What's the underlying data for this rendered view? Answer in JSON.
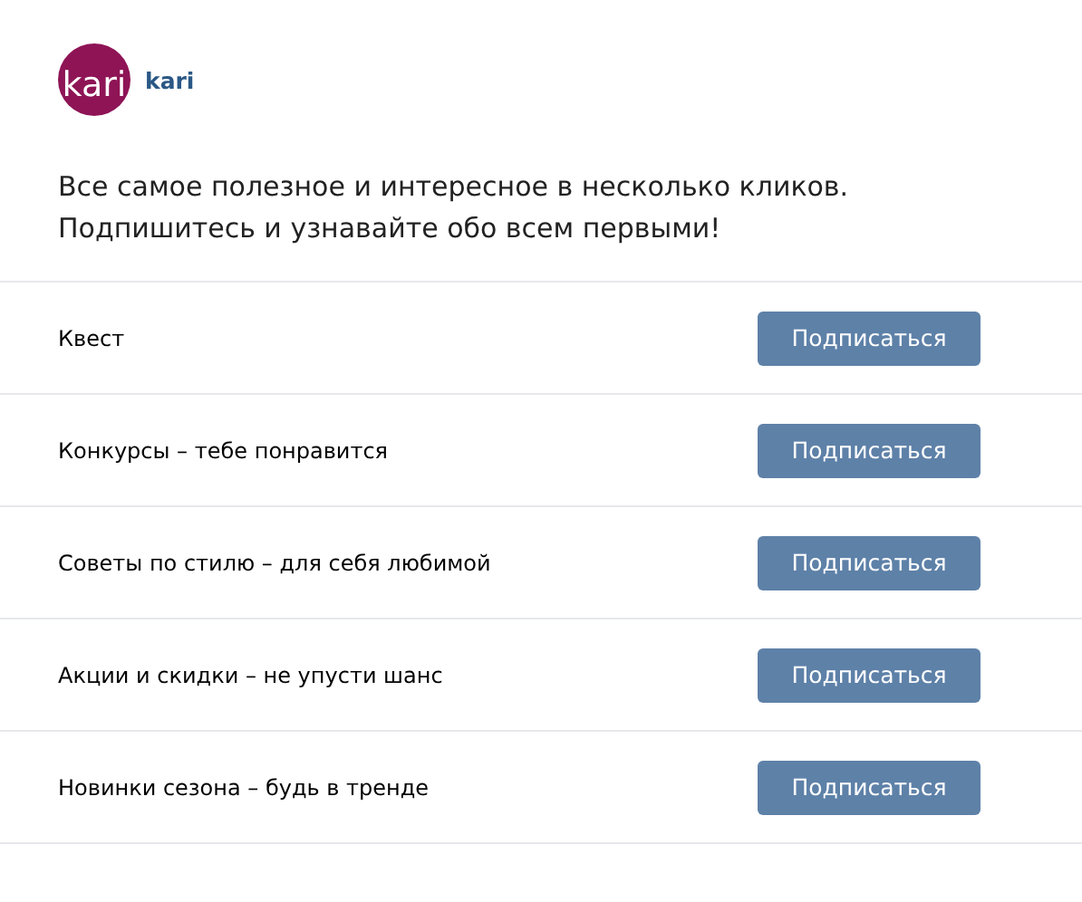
{
  "community": {
    "logo_text": "kari",
    "name": "kari"
  },
  "description": [
    "Все самое полезное и интересное в несколько кликов.",
    "Подпишитесь и узнавайте обо всем первыми!"
  ],
  "subscriptions": [
    {
      "title": "Квест",
      "button": "Подписаться"
    },
    {
      "title": "Конкурсы – тебе понравится",
      "button": "Подписаться"
    },
    {
      "title": "Советы по стилю – для себя любимой",
      "button": "Подписаться"
    },
    {
      "title": "Акции и скидки – не упусти шанс",
      "button": "Подписаться"
    },
    {
      "title": "Новинки сезона – будь в тренде",
      "button": "Подписаться"
    }
  ]
}
